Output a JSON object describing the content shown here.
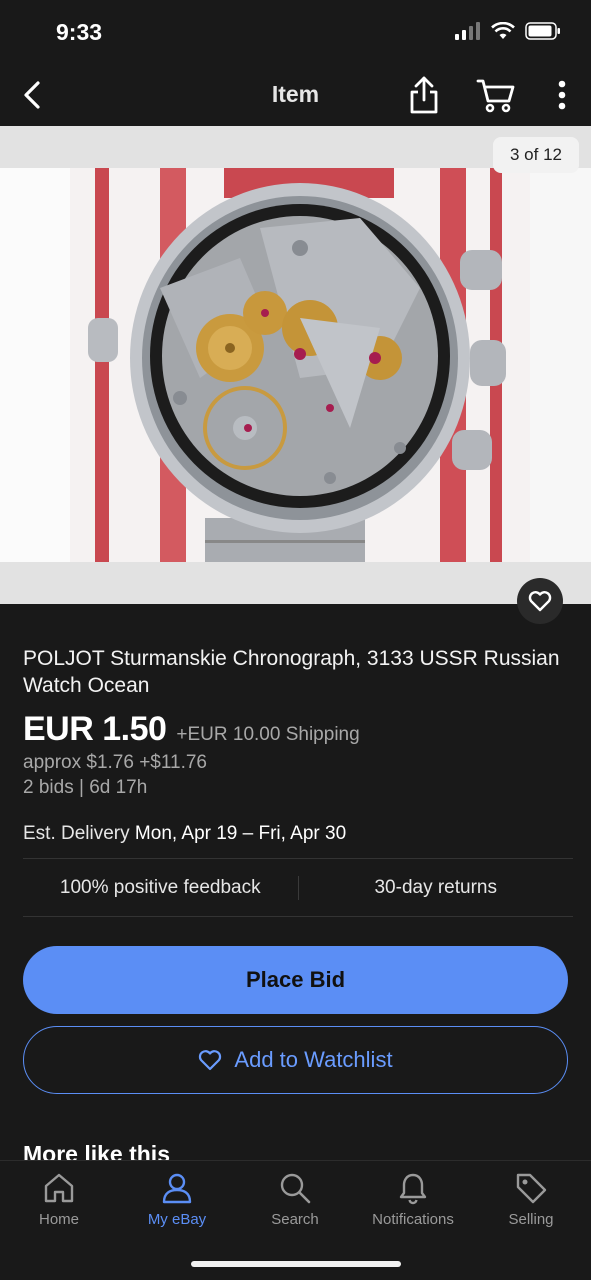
{
  "status": {
    "time": "9:33"
  },
  "nav": {
    "title": "Item"
  },
  "gallery": {
    "counter": "3 of 12"
  },
  "item": {
    "title": "POLJOT Sturmanskie Chronograph, 3133 USSR Russian Watch Ocean",
    "price": "EUR 1.50",
    "shipping": "+EUR 10.00 Shipping",
    "approx": "approx $1.76 +$11.76",
    "bids": "2 bids  |  6d 17h",
    "delivery_label": "Est. Delivery",
    "delivery_dates": "Mon, Apr 19 – Fri, Apr 30",
    "feedback": "100% positive feedback",
    "returns": "30-day returns"
  },
  "actions": {
    "place_bid": "Place Bid",
    "add_watchlist": "Add to Watchlist"
  },
  "section": {
    "more_like": "More like this"
  },
  "tabs": [
    {
      "label": "Home",
      "icon": "home-icon"
    },
    {
      "label": "My eBay",
      "icon": "person-icon"
    },
    {
      "label": "Search",
      "icon": "search-icon"
    },
    {
      "label": "Notifications",
      "icon": "bell-icon"
    },
    {
      "label": "Selling",
      "icon": "tag-icon"
    }
  ],
  "colors": {
    "accent": "#5b8ef5",
    "background": "#191919"
  }
}
